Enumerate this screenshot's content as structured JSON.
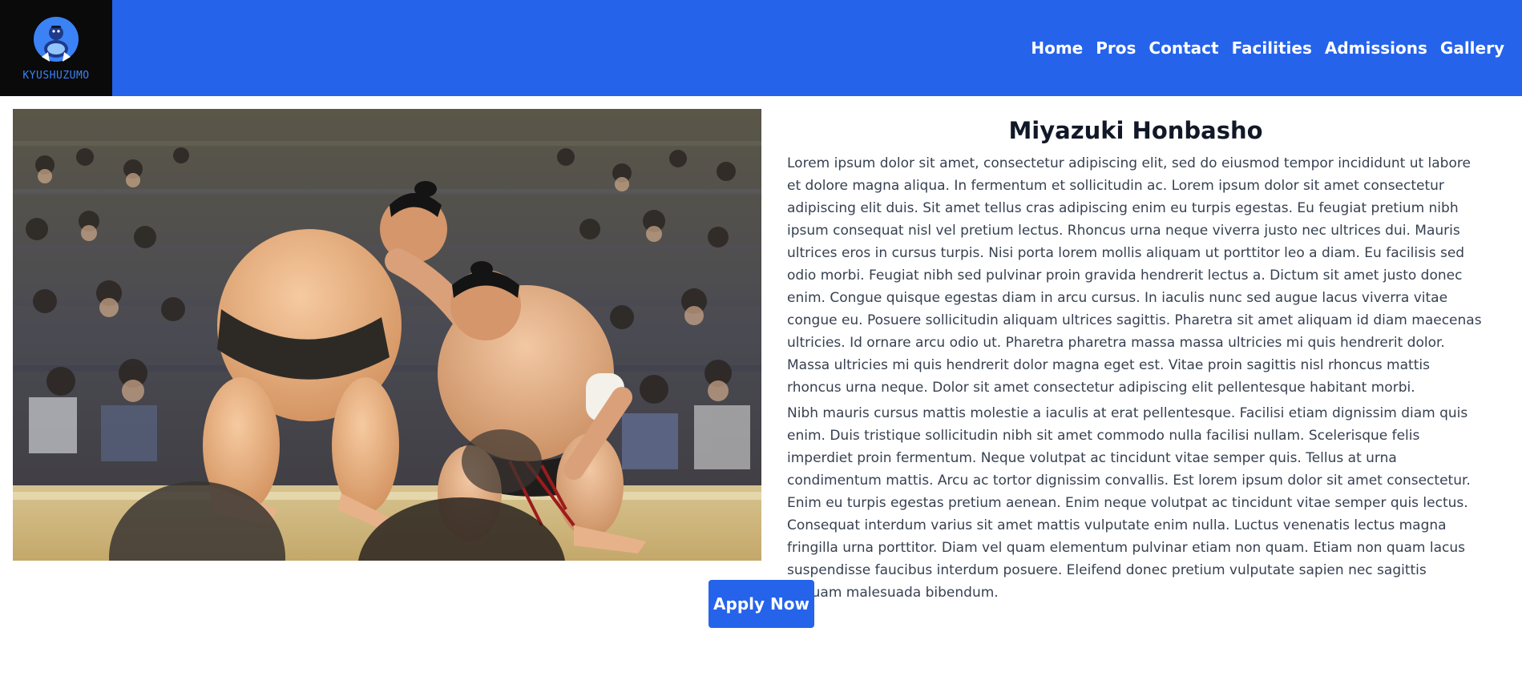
{
  "header": {
    "logo_text": "KYUSHUZUMO",
    "nav": [
      "Home",
      "Pros",
      "Contact",
      "Facilities",
      "Admissions",
      "Gallery"
    ]
  },
  "photo": {
    "alt": "Two sumo wrestlers grappling in a ring in front of a crowd"
  },
  "main": {
    "title": "Miyazuki Honbasho",
    "paragraphs": [
      "Lorem ipsum dolor sit amet, consectetur adipiscing elit, sed do eiusmod tempor incididunt ut labore et dolore magna aliqua. In fermentum et sollicitudin ac. Lorem ipsum dolor sit amet consectetur adipiscing elit duis. Sit amet tellus cras adipiscing enim eu turpis egestas. Eu feugiat pretium nibh ipsum consequat nisl vel pretium lectus. Rhoncus urna neque viverra justo nec ultrices dui. Mauris ultrices eros in cursus turpis. Nisi porta lorem mollis aliquam ut porttitor leo a diam. Eu facilisis sed odio morbi. Feugiat nibh sed pulvinar proin gravida hendrerit lectus a. Dictum sit amet justo donec enim. Congue quisque egestas diam in arcu cursus. In iaculis nunc sed augue lacus viverra vitae congue eu. Posuere sollicitudin aliquam ultrices sagittis. Pharetra sit amet aliquam id diam maecenas ultricies. Id ornare arcu odio ut. Pharetra pharetra massa massa ultricies mi quis hendrerit dolor. Massa ultricies mi quis hendrerit dolor magna eget est. Vitae proin sagittis nisl rhoncus mattis rhoncus urna neque. Dolor sit amet consectetur adipiscing elit pellentesque habitant morbi.",
      "Nibh mauris cursus mattis molestie a iaculis at erat pellentesque. Facilisi etiam dignissim diam quis enim. Duis tristique sollicitudin nibh sit amet commodo nulla facilisi nullam. Scelerisque felis imperdiet proin fermentum. Neque volutpat ac tincidunt vitae semper quis. Tellus at urna condimentum mattis. Arcu ac tortor dignissim convallis. Est lorem ipsum dolor sit amet consectetur. Enim eu turpis egestas pretium aenean. Enim neque volutpat ac tincidunt vitae semper quis lectus. Consequat interdum varius sit amet mattis vulputate enim nulla. Luctus venenatis lectus magna fringilla urna porttitor. Diam vel quam elementum pulvinar etiam non quam. Etiam non quam lacus suspendisse faucibus interdum posuere. Eleifend donec pretium vulputate sapien nec sagittis aliquam malesuada bibendum."
    ]
  },
  "cta": {
    "label": "Apply Now"
  },
  "colors": {
    "brand": "#2563eb",
    "logo_bg": "#0a0a0a",
    "title": "#111827",
    "body_text": "#374151"
  }
}
